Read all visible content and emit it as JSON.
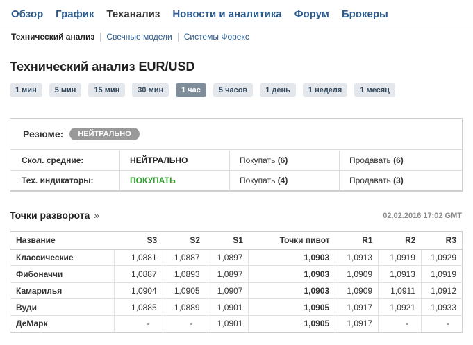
{
  "nav": {
    "items": [
      "Обзор",
      "График",
      "Теханализ",
      "Новости и аналитика",
      "Форум",
      "Брокеры"
    ],
    "active": "Теханализ"
  },
  "subnav": {
    "items": [
      "Технический анализ",
      "Свечные модели",
      "Системы Форекс"
    ],
    "active": "Технический анализ"
  },
  "title": "Технический анализ EUR/USD",
  "periods": {
    "items": [
      "1 мин",
      "5 мин",
      "15 мин",
      "30 мин",
      "1 час",
      "5 часов",
      "1 день",
      "1 неделя",
      "1 месяц"
    ],
    "active": "1 час"
  },
  "summary": {
    "label": "Резюме:",
    "badge": "НЕЙТРАЛЬНО",
    "rows": [
      {
        "label": "Скол. средние:",
        "value": "НЕЙТРАЛЬНО",
        "buy_text": "Покупать",
        "buy_count": "(6)",
        "sell_text": "Продавать",
        "sell_count": "(6)"
      },
      {
        "label": "Тех. индикаторы:",
        "value": "ПОКУПАТЬ",
        "buy_text": "Покупать",
        "buy_count": "(4)",
        "sell_text": "Продавать",
        "sell_count": "(3)"
      }
    ],
    "colors": {
      "neutral": "#222222",
      "buy": "#2e9e2e",
      "badge": "#999999"
    }
  },
  "pivots": {
    "title": "Точки разворота",
    "arrow": "»",
    "date": "02.02.2016 17:02 GMT",
    "headers": [
      "Название",
      "S3",
      "S2",
      "S1",
      "Точки пивот",
      "R1",
      "R2",
      "R3"
    ],
    "rows": [
      [
        "Классические",
        "1,0881",
        "1,0887",
        "1,0897",
        "1,0903",
        "1,0913",
        "1,0919",
        "1,0929"
      ],
      [
        "Фибоначчи",
        "1,0887",
        "1,0893",
        "1,0897",
        "1,0903",
        "1,0909",
        "1,0913",
        "1,0919"
      ],
      [
        "Камарилья",
        "1,0904",
        "1,0905",
        "1,0907",
        "1,0903",
        "1,0909",
        "1,0911",
        "1,0912"
      ],
      [
        "Вуди",
        "1,0885",
        "1,0889",
        "1,0901",
        "1,0905",
        "1,0917",
        "1,0921",
        "1,0933"
      ],
      [
        "ДеМарк",
        "-",
        "-",
        "1,0901",
        "1,0905",
        "1,0917",
        "-",
        "-"
      ]
    ]
  }
}
